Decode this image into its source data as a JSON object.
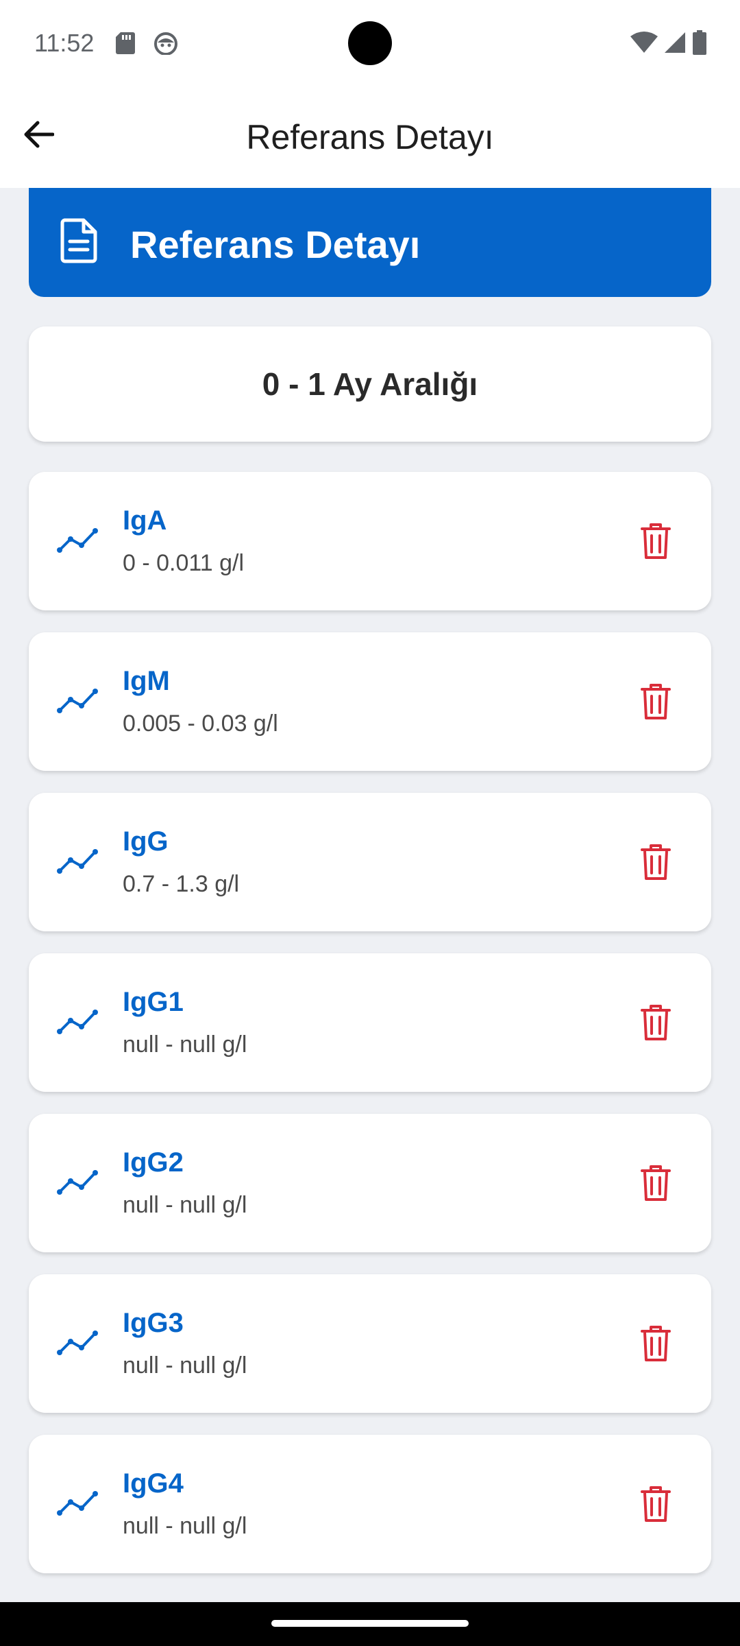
{
  "status_bar": {
    "time": "11:52",
    "icons_left": [
      "sd-card-icon",
      "android-debug-icon"
    ],
    "icons_right": [
      "wifi-icon",
      "signal-icon",
      "battery-icon"
    ]
  },
  "app_bar": {
    "back_icon": "arrow-left-icon",
    "title": "Referans Detayı"
  },
  "header": {
    "icon": "document-icon",
    "title": "Referans Detayı",
    "color": "#0665c9"
  },
  "range": {
    "title": "0 - 1 Ay Aralığı"
  },
  "items": [
    {
      "name": "IgA",
      "range": "0 - 0.011 g/l"
    },
    {
      "name": "IgM",
      "range": "0.005 - 0.03 g/l"
    },
    {
      "name": "IgG",
      "range": "0.7 - 1.3 g/l"
    },
    {
      "name": "IgG1",
      "range": "null - null g/l"
    },
    {
      "name": "IgG2",
      "range": "null - null g/l"
    },
    {
      "name": "IgG3",
      "range": "null - null g/l"
    },
    {
      "name": "IgG4",
      "range": "null - null g/l"
    }
  ],
  "colors": {
    "accent": "#0665c9",
    "delete": "#d92d3a",
    "background": "#eef0f4"
  }
}
